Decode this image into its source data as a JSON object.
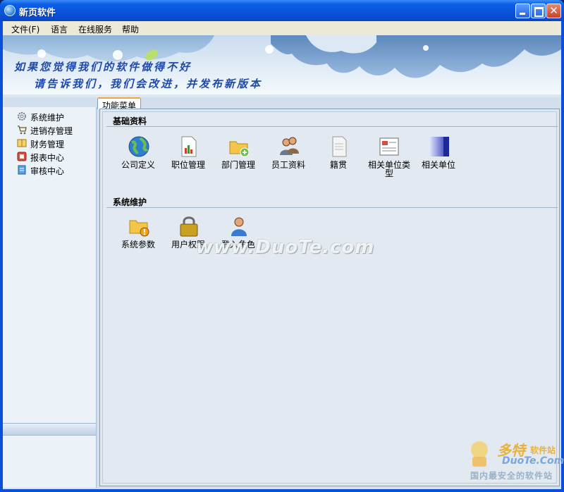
{
  "window": {
    "title": "新页软件"
  },
  "menu": [
    "文件(F)",
    "语言",
    "在线服务",
    "帮助"
  ],
  "banner": {
    "line1": "如果您觉得我们的软件做得不好",
    "line2": "请告诉我们，我们会改进，并发布新版本"
  },
  "sidebar": {
    "items": [
      {
        "label": "系统维护",
        "icon": "gear-icon"
      },
      {
        "label": "进销存管理",
        "icon": "cart-icon"
      },
      {
        "label": "财务管理",
        "icon": "book-icon"
      },
      {
        "label": "报表中心",
        "icon": "report-icon"
      },
      {
        "label": "审核中心",
        "icon": "audit-icon"
      }
    ]
  },
  "tab": {
    "label": "功能菜单"
  },
  "sections": [
    {
      "title": "基础资料",
      "items": [
        {
          "label": "公司定义",
          "icon": "globe-icon"
        },
        {
          "label": "职位管理",
          "icon": "chart-doc-icon"
        },
        {
          "label": "部门管理",
          "icon": "folder-add-icon"
        },
        {
          "label": "员工资料",
          "icon": "users-icon"
        },
        {
          "label": "籍贯",
          "icon": "document-icon"
        },
        {
          "label": "相关单位类型",
          "icon": "form-icon"
        },
        {
          "label": "相关单位",
          "icon": "bars-icon"
        }
      ]
    },
    {
      "title": "系统维护",
      "items": [
        {
          "label": "系统参数",
          "icon": "folder-settings-icon"
        },
        {
          "label": "用户权限",
          "icon": "lock-icon"
        },
        {
          "label": "登入角色",
          "icon": "user-icon"
        }
      ]
    }
  ],
  "watermark": {
    "center": "www.DuoTe.com",
    "brand": "多特",
    "brand_sub": "软件站",
    "site": "DuoTe.Com",
    "slogan": "国内最安全的软件站"
  }
}
